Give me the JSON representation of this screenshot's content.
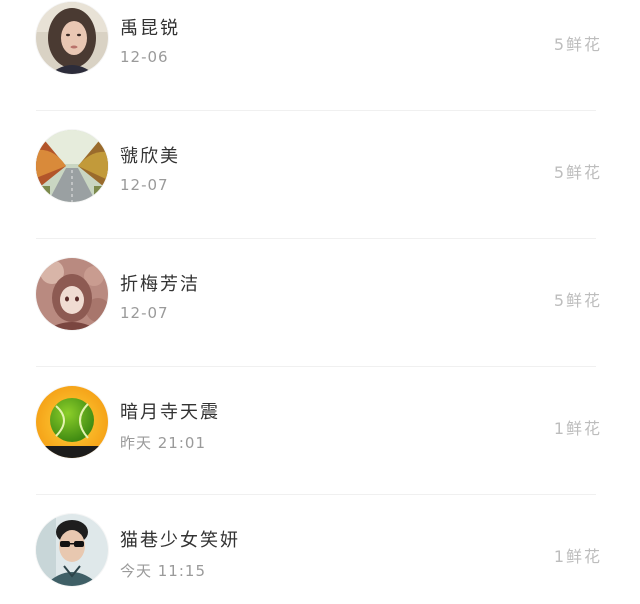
{
  "entries": [
    {
      "name": "禹昆锐",
      "time": "12-06",
      "flowers": "5鲜花",
      "avatar": "woman-portrait-avatar"
    },
    {
      "name": "虢欣美",
      "time": "12-07",
      "flowers": "5鲜花",
      "avatar": "autumn-road-avatar"
    },
    {
      "name": "折梅芳洁",
      "time": "12-07",
      "flowers": "5鲜花",
      "avatar": "anime-girl-avatar"
    },
    {
      "name": "暗月寺天震",
      "time": "昨天 21:01",
      "flowers": "1鲜花",
      "avatar": "tennis-ball-avatar"
    },
    {
      "name": "猫巷少女笑妍",
      "time": "今天 11:15",
      "flowers": "1鲜花",
      "avatar": "sunglasses-man-avatar"
    }
  ]
}
